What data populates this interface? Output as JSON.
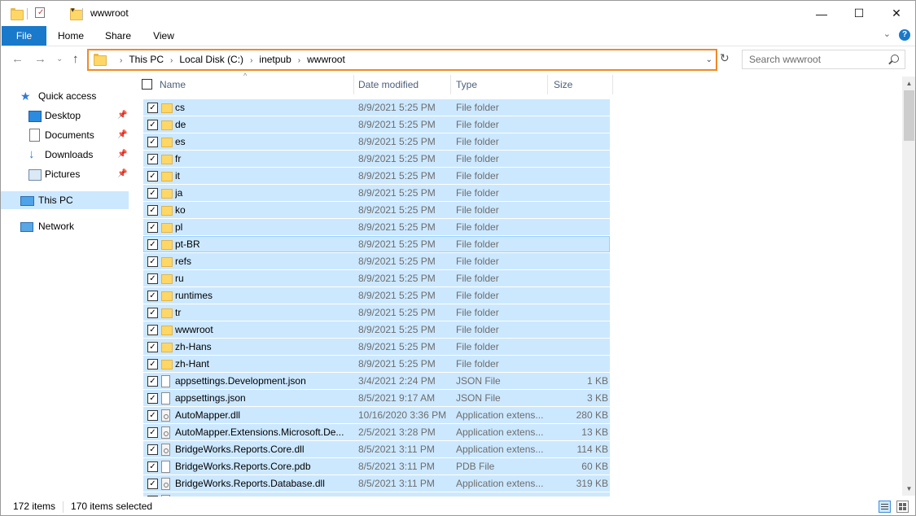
{
  "window": {
    "title": "wwwroot",
    "minimize_glyph": "—",
    "maximize_glyph": "☐",
    "close_glyph": "✕"
  },
  "ribbon": {
    "tabs": [
      "File",
      "Home",
      "Share",
      "View"
    ],
    "expand_glyph": "⌄",
    "help_glyph": "?"
  },
  "nav_buttons": {
    "back": "←",
    "forward": "→",
    "recent": "⌄",
    "up": "↑"
  },
  "address": {
    "crumbs": [
      "This PC",
      "Local Disk (C:)",
      "inetpub",
      "wwwroot"
    ],
    "separator": "›",
    "dropdown_glyph": "⌄",
    "refresh_glyph": "↻"
  },
  "search": {
    "placeholder": "Search wwwroot"
  },
  "navpane": {
    "quick_access": "Quick access",
    "desktop": "Desktop",
    "documents": "Documents",
    "downloads": "Downloads",
    "pictures": "Pictures",
    "this_pc": "This PC",
    "network": "Network",
    "pin_glyph": "📌"
  },
  "columns": {
    "name": "Name",
    "date": "Date modified",
    "type": "Type",
    "size": "Size",
    "sort_glyph": "^"
  },
  "files": [
    {
      "name": "cs",
      "date": "8/9/2021 5:25 PM",
      "type": "File folder",
      "size": "",
      "kind": "folder"
    },
    {
      "name": "de",
      "date": "8/9/2021 5:25 PM",
      "type": "File folder",
      "size": "",
      "kind": "folder"
    },
    {
      "name": "es",
      "date": "8/9/2021 5:25 PM",
      "type": "File folder",
      "size": "",
      "kind": "folder"
    },
    {
      "name": "fr",
      "date": "8/9/2021 5:25 PM",
      "type": "File folder",
      "size": "",
      "kind": "folder"
    },
    {
      "name": "it",
      "date": "8/9/2021 5:25 PM",
      "type": "File folder",
      "size": "",
      "kind": "folder"
    },
    {
      "name": "ja",
      "date": "8/9/2021 5:25 PM",
      "type": "File folder",
      "size": "",
      "kind": "folder"
    },
    {
      "name": "ko",
      "date": "8/9/2021 5:25 PM",
      "type": "File folder",
      "size": "",
      "kind": "folder"
    },
    {
      "name": "pl",
      "date": "8/9/2021 5:25 PM",
      "type": "File folder",
      "size": "",
      "kind": "folder"
    },
    {
      "name": "pt-BR",
      "date": "8/9/2021 5:25 PM",
      "type": "File folder",
      "size": "",
      "kind": "folder"
    },
    {
      "name": "refs",
      "date": "8/9/2021 5:25 PM",
      "type": "File folder",
      "size": "",
      "kind": "folder"
    },
    {
      "name": "ru",
      "date": "8/9/2021 5:25 PM",
      "type": "File folder",
      "size": "",
      "kind": "folder"
    },
    {
      "name": "runtimes",
      "date": "8/9/2021 5:25 PM",
      "type": "File folder",
      "size": "",
      "kind": "folder"
    },
    {
      "name": "tr",
      "date": "8/9/2021 5:25 PM",
      "type": "File folder",
      "size": "",
      "kind": "folder"
    },
    {
      "name": "wwwroot",
      "date": "8/9/2021 5:25 PM",
      "type": "File folder",
      "size": "",
      "kind": "folder"
    },
    {
      "name": "zh-Hans",
      "date": "8/9/2021 5:25 PM",
      "type": "File folder",
      "size": "",
      "kind": "folder"
    },
    {
      "name": "zh-Hant",
      "date": "8/9/2021 5:25 PM",
      "type": "File folder",
      "size": "",
      "kind": "folder"
    },
    {
      "name": "appsettings.Development.json",
      "date": "3/4/2021 2:24 PM",
      "type": "JSON File",
      "size": "1 KB",
      "kind": "file"
    },
    {
      "name": "appsettings.json",
      "date": "8/5/2021 9:17 AM",
      "type": "JSON File",
      "size": "3 KB",
      "kind": "file"
    },
    {
      "name": "AutoMapper.dll",
      "date": "10/16/2020 3:36 PM",
      "type": "Application extens...",
      "size": "280 KB",
      "kind": "dll"
    },
    {
      "name": "AutoMapper.Extensions.Microsoft.De...",
      "date": "2/5/2021 3:28 PM",
      "type": "Application extens...",
      "size": "13 KB",
      "kind": "dll"
    },
    {
      "name": "BridgeWorks.Reports.Core.dll",
      "date": "8/5/2021 3:11 PM",
      "type": "Application extens...",
      "size": "114 KB",
      "kind": "dll"
    },
    {
      "name": "BridgeWorks.Reports.Core.pdb",
      "date": "8/5/2021 3:11 PM",
      "type": "PDB File",
      "size": "60 KB",
      "kind": "file"
    },
    {
      "name": "BridgeWorks.Reports.Database.dll",
      "date": "8/5/2021 3:11 PM",
      "type": "Application extens...",
      "size": "319 KB",
      "kind": "dll"
    },
    {
      "name": "",
      "date": "",
      "type": "",
      "size": "",
      "kind": "dll"
    }
  ],
  "focused_row": 8,
  "check_glyph": "✓",
  "scrollbar": {
    "up": "▲",
    "down": "▼"
  },
  "status": {
    "items": "172 items",
    "selected": "170 items selected"
  }
}
